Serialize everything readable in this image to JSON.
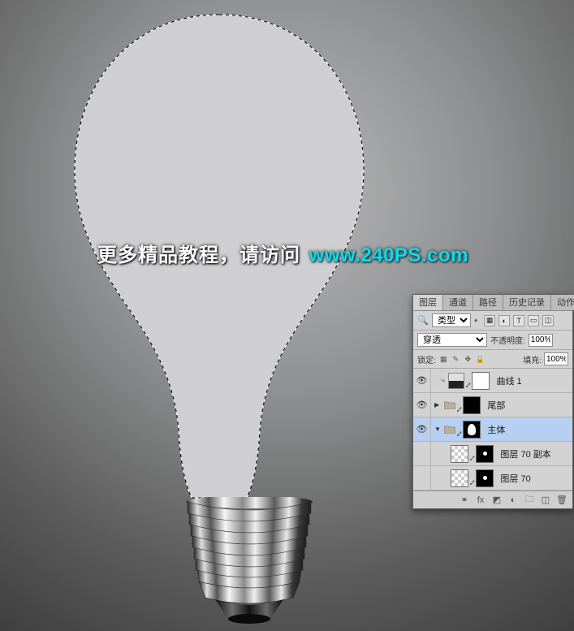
{
  "watermark": {
    "text1": "更多精品教程，请访问",
    "text2": "www.240PS.com"
  },
  "panel": {
    "tabs": {
      "layers": "图层",
      "channels": "通道",
      "paths": "路径",
      "history": "历史记录",
      "actions": "动作"
    },
    "filter": {
      "kind": "类型"
    },
    "blend": {
      "mode": "穿透",
      "opacity_label": "不透明度:",
      "opacity_value": "100%",
      "fill_label": "填充:",
      "fill_value": "100%",
      "lock_label": "锁定:"
    },
    "layers": [
      {
        "id": "curves1",
        "name": "曲线 1",
        "visible": true,
        "type": "adjustment",
        "indent": 1
      },
      {
        "id": "tail",
        "name": "尾部",
        "visible": true,
        "type": "group",
        "indent": 0,
        "open": false,
        "mask": "black"
      },
      {
        "id": "body",
        "name": "主体",
        "visible": true,
        "type": "group",
        "indent": 0,
        "open": true,
        "mask": "bulb",
        "selected": true
      },
      {
        "id": "l70copy",
        "name": "图层 70 副本",
        "visible": false,
        "type": "layer",
        "indent": 1,
        "mask": "dot"
      },
      {
        "id": "l70",
        "name": "图层 70",
        "visible": false,
        "type": "layer",
        "indent": 1,
        "mask": "dot"
      }
    ],
    "footer": {
      "fx": "fx"
    }
  }
}
